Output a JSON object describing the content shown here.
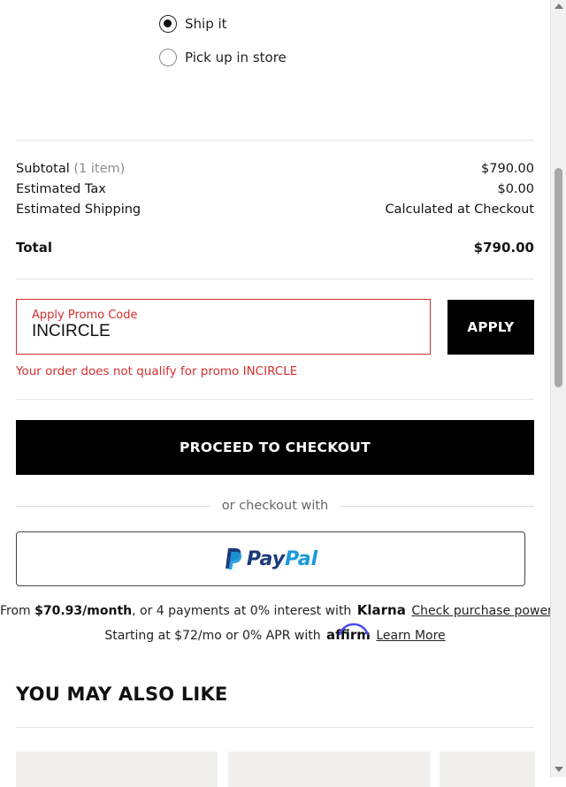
{
  "fulfillment": {
    "options": [
      {
        "label": "Ship it",
        "selected": true
      },
      {
        "label": "Pick up in store",
        "selected": false
      }
    ]
  },
  "summary": {
    "subtotal_label": "Subtotal",
    "subtotal_count": "(1 item)",
    "subtotal_value": "$790.00",
    "tax_label": "Estimated Tax",
    "tax_value": "$0.00",
    "shipping_label": "Estimated Shipping",
    "shipping_value": "Calculated at Checkout",
    "total_label": "Total",
    "total_value": "$790.00"
  },
  "promo": {
    "label": "Apply Promo Code",
    "value": "INCIRCLE",
    "apply_label": "APPLY",
    "error": "Your order does not qualify for promo INCIRCLE"
  },
  "checkout": {
    "proceed_label": "PROCEED TO CHECKOUT",
    "or_text": "or checkout with",
    "paypal_pay": "Pay",
    "paypal_pal": "Pal"
  },
  "financing": {
    "klarna_prefix": "From ",
    "klarna_amount": "$70.93/month",
    "klarna_middle": ", or 4 payments at 0% interest with ",
    "klarna_logo": "Klarna",
    "klarna_link": "Check purchase power",
    "affirm_prefix": "Starting at $72/mo or 0% APR with ",
    "affirm_logo": "affirm",
    "affirm_link": "Learn More"
  },
  "recommendations": {
    "title": "YOU MAY ALSO LIKE"
  },
  "colors": {
    "error": "#d32f2f",
    "primary_button": "#000000",
    "paypal_dark": "#1e3a7b",
    "paypal_light": "#1a9ad9",
    "affirm_arc": "#4a4af4",
    "card_bg": "#f0efeb"
  }
}
